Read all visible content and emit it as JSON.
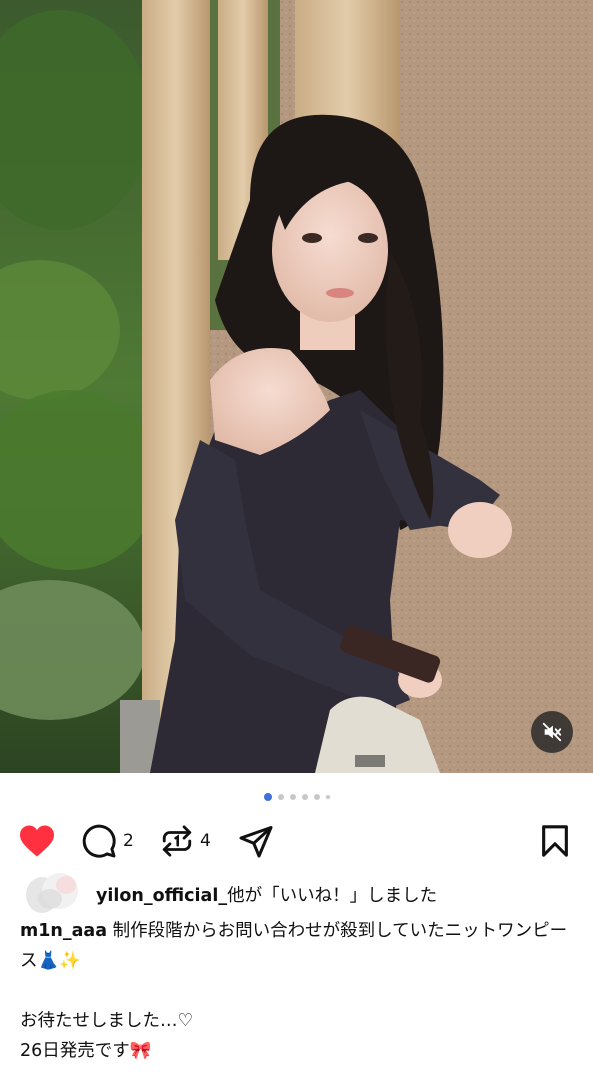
{
  "post": {
    "media": {
      "carousel_count": 7,
      "active_index": 0,
      "sound": "muted"
    },
    "actions": {
      "liked": true,
      "comment_count": "2",
      "repost_count": "4"
    },
    "liked_by": {
      "username": "yilon_official_",
      "suffix": "他が「いいね！」しました"
    },
    "caption": {
      "username": "m1n_aaa",
      "line1": " 制作段階からお問い合わせが殺到していたニットワンピース👗✨",
      "line2": "お待たせしました…♡",
      "line3": "26日発売です🎀"
    }
  },
  "icons": {
    "heart": "heart-icon",
    "comment": "comment-icon",
    "repost": "repost-icon",
    "share": "share-icon",
    "bookmark": "bookmark-icon",
    "mute": "sound-off-icon"
  },
  "colors": {
    "like_red": "#ff3040",
    "active_dot": "#3f6fd8"
  }
}
